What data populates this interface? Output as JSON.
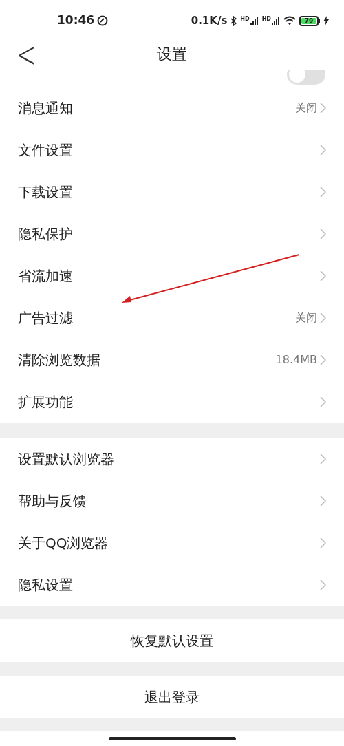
{
  "status_bar": {
    "time": "10:46",
    "speed": "0.1K/s",
    "battery": "79",
    "signal_labels": [
      "HD",
      "HD"
    ]
  },
  "header": {
    "back": "<",
    "title": "设置"
  },
  "cut_row": {
    "kind": "toggle",
    "on": false
  },
  "groups": [
    {
      "items": [
        {
          "label": "消息通知",
          "value": "关闭"
        },
        {
          "label": "文件设置"
        },
        {
          "label": "下载设置"
        },
        {
          "label": "隐私保护"
        },
        {
          "label": "省流加速"
        },
        {
          "label": "广告过滤",
          "value": "关闭"
        },
        {
          "label": "清除浏览数据",
          "value": "18.4MB"
        },
        {
          "label": "扩展功能"
        }
      ]
    },
    {
      "items": [
        {
          "label": "设置默认浏览器"
        },
        {
          "label": "帮助与反馈"
        },
        {
          "label": "关于QQ浏览器"
        },
        {
          "label": "隐私设置"
        }
      ]
    }
  ],
  "buttons": [
    "恢复默认设置",
    "退出登录"
  ]
}
